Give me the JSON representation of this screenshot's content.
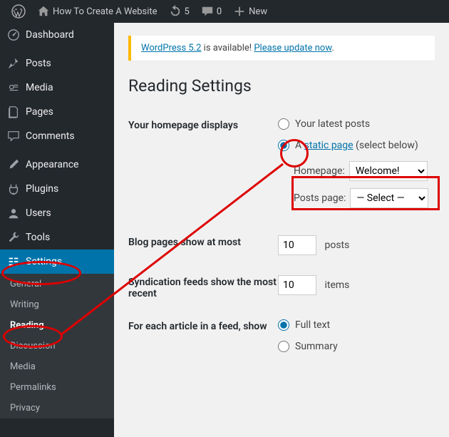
{
  "topbar": {
    "site_name": "How To Create A Website",
    "updates_count": "5",
    "comments_count": "0",
    "new_label": "New"
  },
  "sidebar": {
    "dashboard": "Dashboard",
    "posts": "Posts",
    "media": "Media",
    "pages": "Pages",
    "comments": "Comments",
    "appearance": "Appearance",
    "plugins": "Plugins",
    "users": "Users",
    "tools": "Tools",
    "settings": "Settings",
    "submenu": {
      "general": "General",
      "writing": "Writing",
      "reading": "Reading",
      "discussion": "Discussion",
      "media": "Media",
      "permalinks": "Permalinks",
      "privacy": "Privacy"
    }
  },
  "notice": {
    "prefix": "WordPress 5.2",
    "mid": " is available! ",
    "link": "Please update now"
  },
  "page": {
    "title": "Reading Settings",
    "homepage_displays_label": "Your homepage displays",
    "latest_posts": "Your latest posts",
    "static_page_prefix": "A ",
    "static_page_link": "static page",
    "static_page_suffix": " (select below)",
    "homepage_label": "Homepage:",
    "homepage_value": "Welcome!",
    "posts_page_label": "Posts page:",
    "posts_page_value": "— Select —",
    "blog_pages_label": "Blog pages show at most",
    "blog_pages_value": "10",
    "blog_pages_unit": "posts",
    "syndication_label": "Syndication feeds show the most recent",
    "syndication_value": "10",
    "syndication_unit": "items",
    "feed_article_label": "For each article in a feed, show",
    "full_text": "Full text",
    "summary": "Summary"
  }
}
